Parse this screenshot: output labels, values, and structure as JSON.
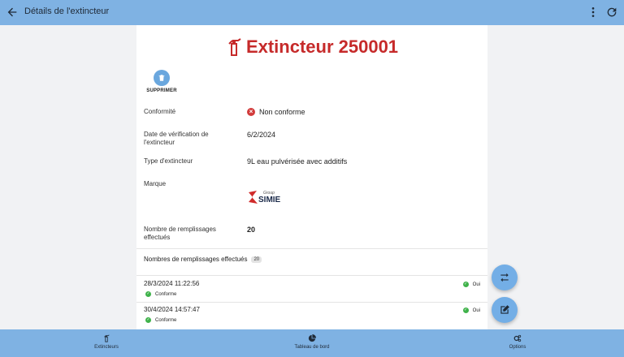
{
  "topbar": {
    "title": "Détails de l'extincteur",
    "back_icon": "arrow-left-icon",
    "more_icon": "more-vertical-icon",
    "refresh_icon": "refresh-icon"
  },
  "heading": {
    "title": "Extincteur 250001",
    "icon": "fire-extinguisher-icon"
  },
  "actions": {
    "delete_label": "SUPPRIMER",
    "delete_icon": "trash-icon"
  },
  "details": [
    {
      "key": "Conformité",
      "value": "Non conforme",
      "status": "non-conforme"
    },
    {
      "key": "Date de vérification de l'extincteur",
      "value": "6/2/2024"
    },
    {
      "key": "Type d'extincteur",
      "value": "9L eau pulvérisée avec additifs"
    },
    {
      "key": "Marque",
      "value": "SIMIE",
      "logo_small_text": "Group"
    },
    {
      "key": "Nombre de remplissages effectués",
      "value": "20"
    }
  ],
  "refills": {
    "title": "Nombres de remplissages effectués",
    "count": "20",
    "items": [
      {
        "datetime": "28/3/2024 11:22:56",
        "status": "Conforme",
        "flag": "Oui"
      },
      {
        "datetime": "30/4/2024 14:57:47",
        "status": "Conforme",
        "flag": "Oui"
      }
    ]
  },
  "fabs": {
    "swap_icon": "swap-icon",
    "edit_icon": "edit-icon"
  },
  "bottom_nav": [
    {
      "label": "Extincteurs",
      "icon": "fire-extinguisher-icon"
    },
    {
      "label": "Tableau de bord",
      "icon": "pie-chart-icon"
    },
    {
      "label": "Options",
      "icon": "gears-icon"
    }
  ],
  "colors": {
    "bar": "#7fb2e3",
    "accent_red": "#c62a2a",
    "fab": "#73aee6",
    "success": "#3fb24a"
  }
}
